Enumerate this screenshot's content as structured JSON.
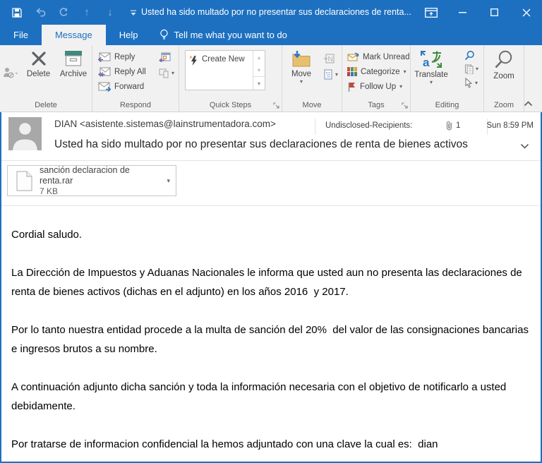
{
  "titlebar": {
    "title": "Usted ha sido multado por no presentar sus declaraciones de renta..."
  },
  "tabs": {
    "file": "File",
    "message": "Message",
    "help": "Help",
    "tellme": "Tell me what you want to do"
  },
  "ribbon": {
    "delete_group": {
      "label": "Delete",
      "delete_btn": "Delete",
      "archive_btn": "Archive"
    },
    "respond_group": {
      "label": "Respond",
      "reply": "Reply",
      "reply_all": "Reply All",
      "forward": "Forward"
    },
    "quicksteps_group": {
      "label": "Quick Steps",
      "create_new": "Create New"
    },
    "move_group": {
      "label": "Move",
      "move_btn": "Move"
    },
    "tags_group": {
      "label": "Tags",
      "mark_unread": "Mark Unread",
      "categorize": "Categorize",
      "follow_up": "Follow Up"
    },
    "editing_group": {
      "label": "Editing",
      "translate": "Translate"
    },
    "zoom_group": {
      "label": "Zoom",
      "zoom_btn": "Zoom"
    }
  },
  "header": {
    "sender": "DIAN <asistente.sistemas@lainstrumentadora.com>",
    "recipients": "Undisclosed-Recipients:",
    "attachment_count": "1",
    "time": "Sun 8:59 PM",
    "subject": "Usted ha sido multado por no presentar sus declaraciones de renta de bienes activos"
  },
  "attachment": {
    "name": "sanción declaracion de renta.rar",
    "size": "7 KB"
  },
  "body": {
    "paragraphs": [
      "Cordial saludo.",
      "La Dirección de Impuestos y Aduanas Nacionales le informa que usted aun no presenta las declaraciones de renta de bienes activos (dichas en el adjunto) en los años 2016  y 2017.",
      "Por lo tanto nuestra entidad procede a la multa de sanción del 20%  del valor de las consignaciones bancarias  e ingresos brutos a su nombre.",
      "A continuación adjunto dicha sanción y toda la información necesaria con el objetivo de notificarlo a usted debidamente.",
      "Por tratarse de informacion confidencial la hemos adjuntado con una clave la cual es:  dian"
    ]
  },
  "colors": {
    "accent": "#1d70c0",
    "ribbon_bg": "#f1f1f1",
    "flag_red": "#c04b3a",
    "archive_teal": "#3e8a7c",
    "folder_tan": "#e6c06e"
  }
}
